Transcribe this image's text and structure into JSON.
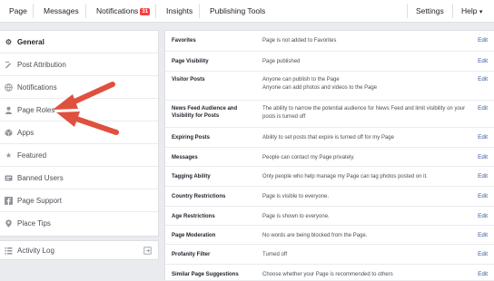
{
  "topnav": {
    "page": "Page",
    "messages": "Messages",
    "notifications": "Notifications",
    "notifications_badge": "31",
    "insights": "Insights",
    "publishing_tools": "Publishing Tools",
    "settings": "Settings",
    "help": "Help",
    "help_caret": "▾"
  },
  "sidebar": {
    "items": [
      {
        "icon": "gear-icon",
        "label": "General"
      },
      {
        "icon": "post-attribution-icon",
        "label": "Post Attribution"
      },
      {
        "icon": "globe-icon",
        "label": "Notifications"
      },
      {
        "icon": "person-icon",
        "label": "Page Roles"
      },
      {
        "icon": "apps-cube-icon",
        "label": "Apps"
      },
      {
        "icon": "star-icon",
        "label": "Featured"
      },
      {
        "icon": "banned-users-icon",
        "label": "Banned Users"
      },
      {
        "icon": "facebook-icon",
        "label": "Page Support"
      },
      {
        "icon": "location-pin-icon",
        "label": "Place Tips"
      }
    ],
    "activity_log": "Activity Log"
  },
  "settings": [
    {
      "label": "Favorites",
      "value": "Page is not added to Favorites",
      "edit": "Edit"
    },
    {
      "label": "Page Visibility",
      "value": "Page published",
      "edit": "Edit"
    },
    {
      "label": "Visitor Posts",
      "value": "Anyone can publish to the Page\nAnyone can add photos and videos to the Page",
      "edit": "Edit"
    },
    {
      "label": "News Feed Audience and Visibility for Posts",
      "value": "The ability to narrow the potential audience for News Feed and limit visibility on your posts is turned off",
      "edit": "Edit"
    },
    {
      "label": "Expiring Posts",
      "value": "Ability to set posts that expire is turned off for my Page",
      "edit": "Edit"
    },
    {
      "label": "Messages",
      "value": "People can contact my Page privately.",
      "edit": "Edit"
    },
    {
      "label": "Tagging Ability",
      "value": "Only people who help manage my Page can tag photos posted on it.",
      "edit": "Edit"
    },
    {
      "label": "Country Restrictions",
      "value": "Page is visible to everyone.",
      "edit": "Edit"
    },
    {
      "label": "Age Restrictions",
      "value": "Page is shown to everyone.",
      "edit": "Edit"
    },
    {
      "label": "Page Moderation",
      "value": "No words are being blocked from the Page.",
      "edit": "Edit"
    },
    {
      "label": "Profanity Filter",
      "value": "Turned off",
      "edit": "Edit"
    },
    {
      "label": "Similar Page Suggestions",
      "value": "Choose whether your Page is recommended to others",
      "edit": "Edit"
    }
  ],
  "colors": {
    "arrow": "#e0503f",
    "link": "#365899"
  }
}
